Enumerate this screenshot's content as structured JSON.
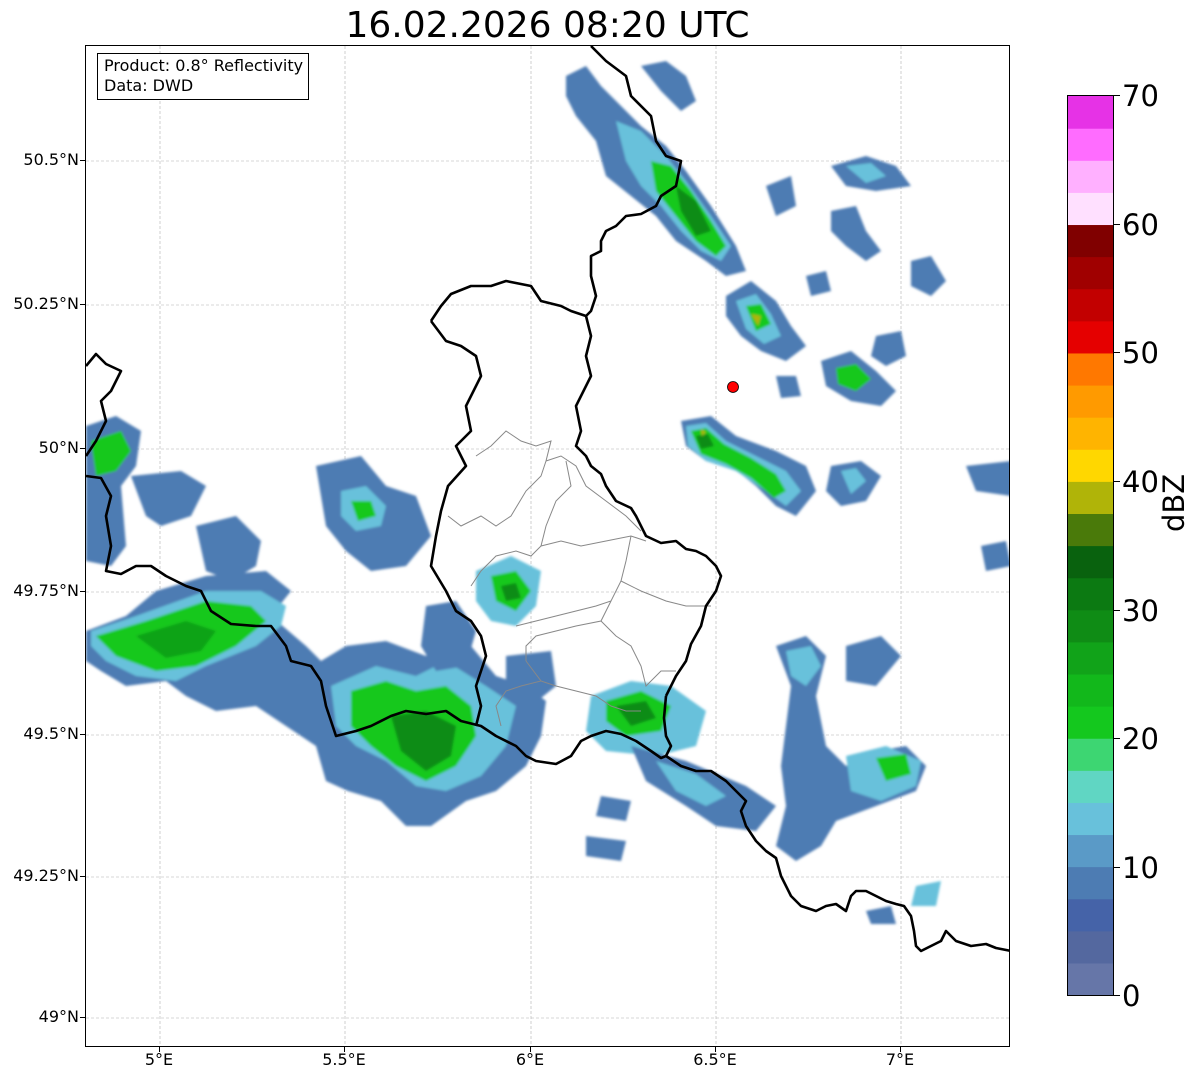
{
  "title": "16.02.2026 08:20 UTC",
  "info": {
    "product": "Product: 0.8° Reflectivity",
    "source": "Data: DWD"
  },
  "axes": {
    "lat_ticks": [
      "50.5°N",
      "50.25°N",
      "50°N",
      "49.75°N",
      "49.5°N",
      "49.25°N",
      "49°N"
    ],
    "lon_ticks": [
      "5°E",
      "5.5°E",
      "6°E",
      "6.5°E",
      "7°E"
    ]
  },
  "colorbar": {
    "label": "dBZ",
    "ticks": [
      "70",
      "60",
      "50",
      "40",
      "30",
      "20",
      "10",
      "0"
    ],
    "colors": [
      "#6676a8",
      "#54689f",
      "#4563a8",
      "#4d7cb3",
      "#5a9ac7",
      "#68c1db",
      "#60d6c3",
      "#3dd672",
      "#14c81e",
      "#12b81b",
      "#11a319",
      "#0f8c15",
      "#0c7a12",
      "#09620e",
      "#4a7a0a",
      "#b0b408",
      "#ffd700",
      "#ffb400",
      "#ff9a00",
      "#ff7800",
      "#e50000",
      "#c20000",
      "#a00000",
      "#800000",
      "#ffe0ff",
      "#ffb0ff",
      "#ff6cff",
      "#e632e6"
    ]
  },
  "radar_site": {
    "color": "#ff0000"
  },
  "colors": {
    "country_border": "#000000",
    "district_border": "#888888",
    "grid": "#b0b0b0"
  }
}
